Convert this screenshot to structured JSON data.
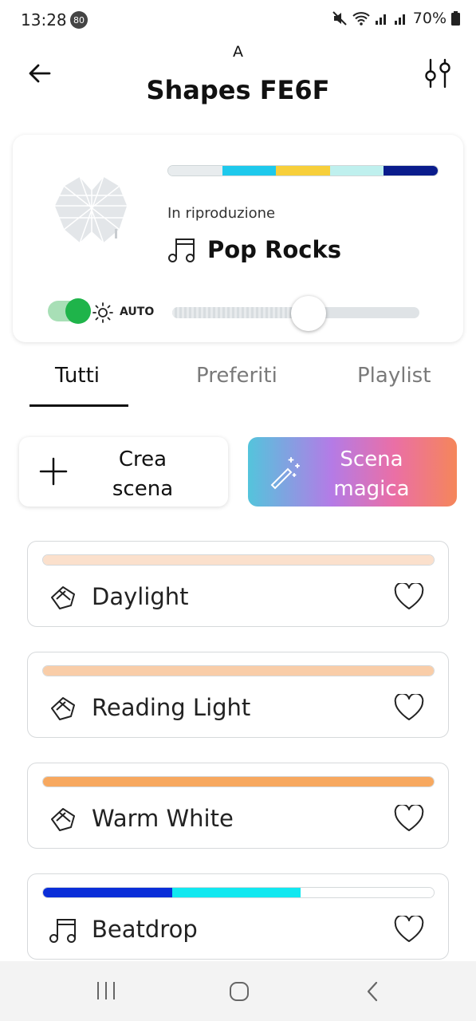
{
  "status_bar": {
    "time": "13:28",
    "badge": "80",
    "battery": "70%"
  },
  "header": {
    "subtitle": "A",
    "title": "Shapes FE6F"
  },
  "device": {
    "palette": [
      "#e8ecee",
      "#1ec9ec",
      "#f7cf3b",
      "#bff0ee",
      "#0a1c8c"
    ],
    "now_playing_label": "In riproduzione",
    "now_playing_name": "Pop Rocks",
    "power_on": true,
    "auto_label": "AUTO",
    "brightness_fraction": 0.55,
    "toggle_color": "#1fb44a"
  },
  "tabs": [
    {
      "label": "Tutti",
      "active": true
    },
    {
      "label": "Preferiti",
      "active": false
    },
    {
      "label": "Playlist",
      "active": false
    }
  ],
  "actions": {
    "create_line1": "Crea",
    "create_line2": "scena",
    "magic_line1": "Scena",
    "magic_line2": "magica"
  },
  "scenes": [
    {
      "name": "Daylight",
      "icon": "scene-plate-icon",
      "colors": [
        {
          "color": "#fbe0cc",
          "fraction": 1.0
        }
      ]
    },
    {
      "name": "Reading Light",
      "icon": "scene-plate-icon",
      "colors": [
        {
          "color": "#f9cda8",
          "fraction": 1.0
        }
      ]
    },
    {
      "name": "Warm White",
      "icon": "scene-plate-icon",
      "colors": [
        {
          "color": "#f7a85f",
          "fraction": 1.0
        }
      ]
    },
    {
      "name": "Beatdrop",
      "icon": "music-note-icon",
      "colors": [
        {
          "color": "#0a2ed8",
          "fraction": 0.33
        },
        {
          "color": "#12e8f0",
          "fraction": 0.33
        },
        {
          "color": "#ffffff",
          "fraction": 0.34
        }
      ]
    }
  ],
  "nav": {
    "icons": [
      "recent-apps-icon",
      "home-icon",
      "back-nav-icon"
    ]
  }
}
